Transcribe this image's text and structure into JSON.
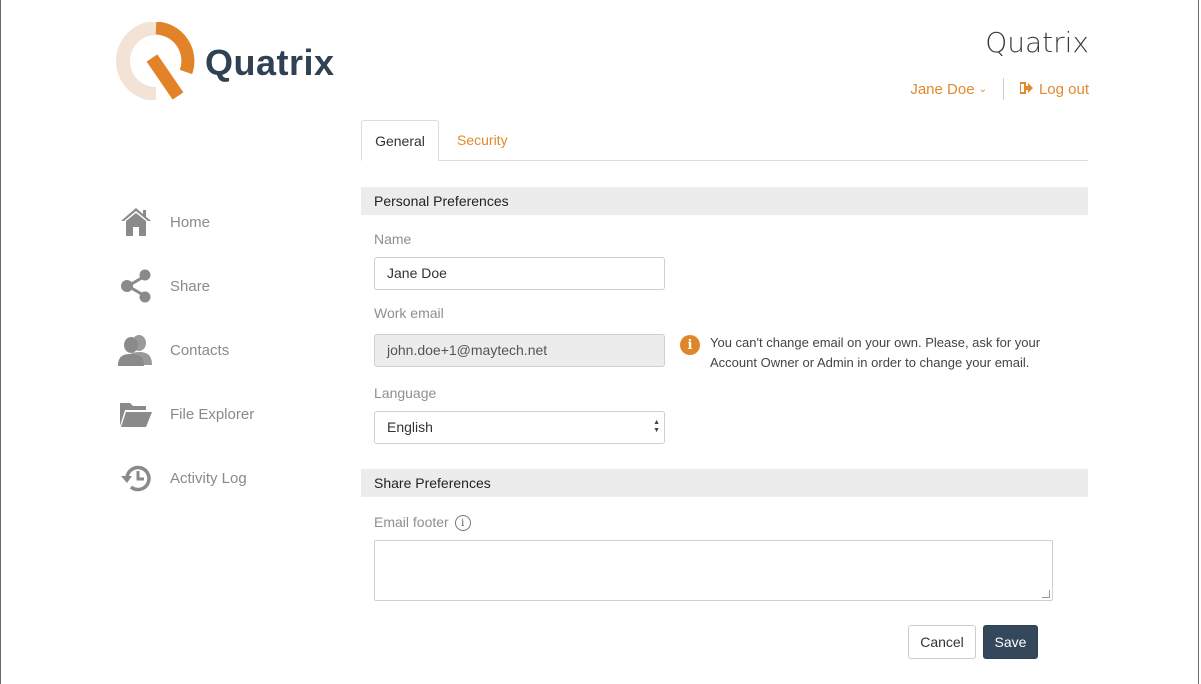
{
  "brand": {
    "logo_text": "Quatrix",
    "app_title": "Quatrix",
    "accent": "#e08a2c",
    "dark": "#2f4153"
  },
  "user_menu": {
    "user_name": "Jane Doe",
    "logout_label": "Log out"
  },
  "sidebar": {
    "items": [
      {
        "label": "Home",
        "icon": "home-icon"
      },
      {
        "label": "Share",
        "icon": "share-icon"
      },
      {
        "label": "Contacts",
        "icon": "contacts-icon"
      },
      {
        "label": "File Explorer",
        "icon": "folder-icon"
      },
      {
        "label": "Activity Log",
        "icon": "history-icon"
      }
    ]
  },
  "tabs": [
    {
      "label": "General",
      "active": true
    },
    {
      "label": "Security",
      "active": false
    }
  ],
  "personal": {
    "header": "Personal Preferences",
    "name_label": "Name",
    "name_value": "Jane Doe",
    "email_label": "Work email",
    "email_value": "john.doe+1@maytech.net",
    "email_note": "You can't change email on your own. Please, ask for your Account Owner or Admin in order to change your email.",
    "language_label": "Language",
    "language_value": "English"
  },
  "share": {
    "header": "Share Preferences",
    "footer_label": "Email footer",
    "footer_value": ""
  },
  "actions": {
    "cancel_label": "Cancel",
    "save_label": "Save"
  }
}
